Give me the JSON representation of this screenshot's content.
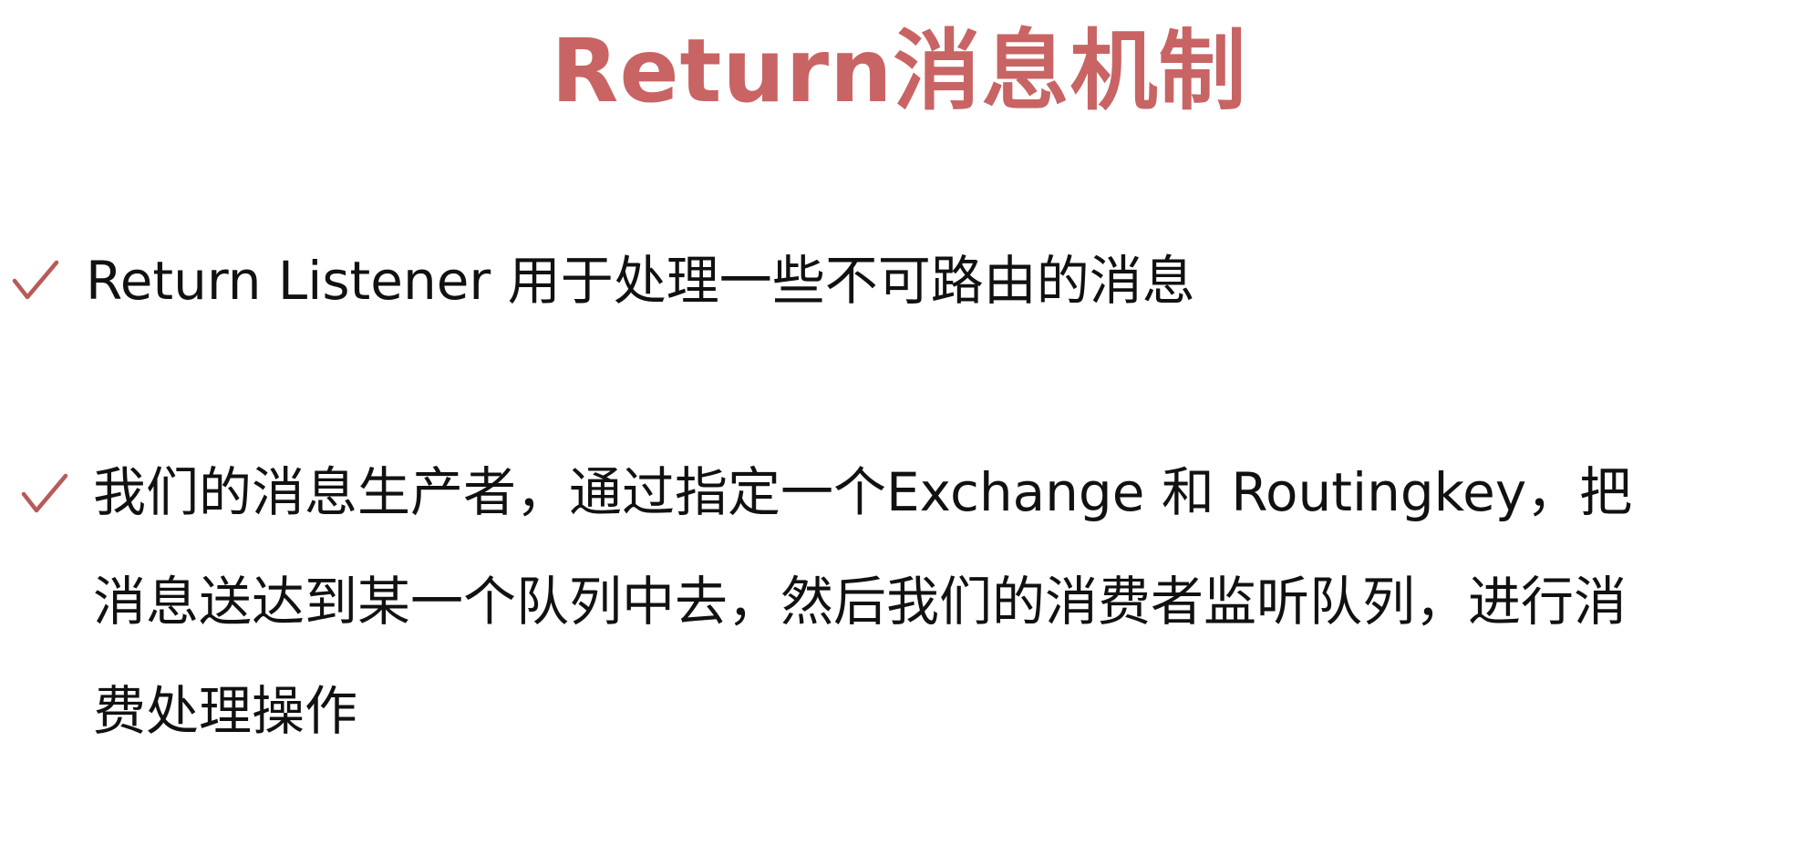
{
  "slide": {
    "title": "Return消息机制",
    "accent_color": "#c96464",
    "check_color": "#b85a5a",
    "bullets": [
      {
        "icon": "check-icon",
        "lines": [
          "Return Listener 用于处理一些不可路由的消息"
        ]
      },
      {
        "icon": "check-icon",
        "lines": [
          "我们的消息生产者，通过指定一个Exchange 和 Routingkey，把",
          "消息送达到某一个队列中去，然后我们的消费者监听队列，进行消",
          "费处理操作"
        ]
      }
    ]
  }
}
